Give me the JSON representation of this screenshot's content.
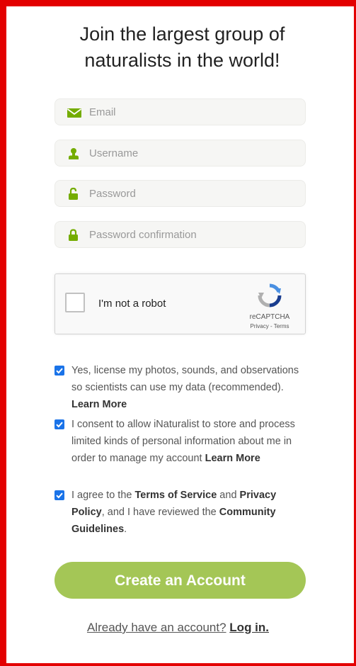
{
  "heading": {
    "line1": "Join the largest group of",
    "line2": "naturalists in the world!"
  },
  "fields": {
    "email": {
      "placeholder": "Email",
      "icon": "envelope-icon"
    },
    "username": {
      "placeholder": "Username",
      "icon": "user-icon"
    },
    "password": {
      "placeholder": "Password",
      "icon": "unlocked-lock-icon"
    },
    "password_confirmation": {
      "placeholder": "Password confirmation",
      "icon": "lock-icon"
    }
  },
  "captcha": {
    "label": "I'm not a robot",
    "brand": "reCAPTCHA",
    "privacy": "Privacy",
    "separator": " - ",
    "terms": "Terms",
    "checked": false
  },
  "consents": [
    {
      "checked": true,
      "text": "Yes, license my photos, sounds, and observations so scientists can use my data (recommended).",
      "link": "Learn More"
    },
    {
      "checked": true,
      "text": "I consent to allow iNaturalist to store and process limited kinds of personal information about me in order to manage my account",
      "link": "Learn More"
    },
    {
      "checked": true,
      "part1": "I agree to the ",
      "terms_link": "Terms of Service",
      "part2": " and ",
      "privacy_link": "Privacy Policy",
      "part3": ", and I have reviewed the ",
      "guidelines_link": "Community Guidelines",
      "part4": "."
    }
  ],
  "create_button": "Create an Account",
  "login": {
    "question": "Already have an account?",
    "link": "Log in."
  },
  "colors": {
    "accent": "#a4c656",
    "icon_green": "#74ac00",
    "checkbox_blue": "#1a73e8",
    "frame_red": "#e30000"
  }
}
